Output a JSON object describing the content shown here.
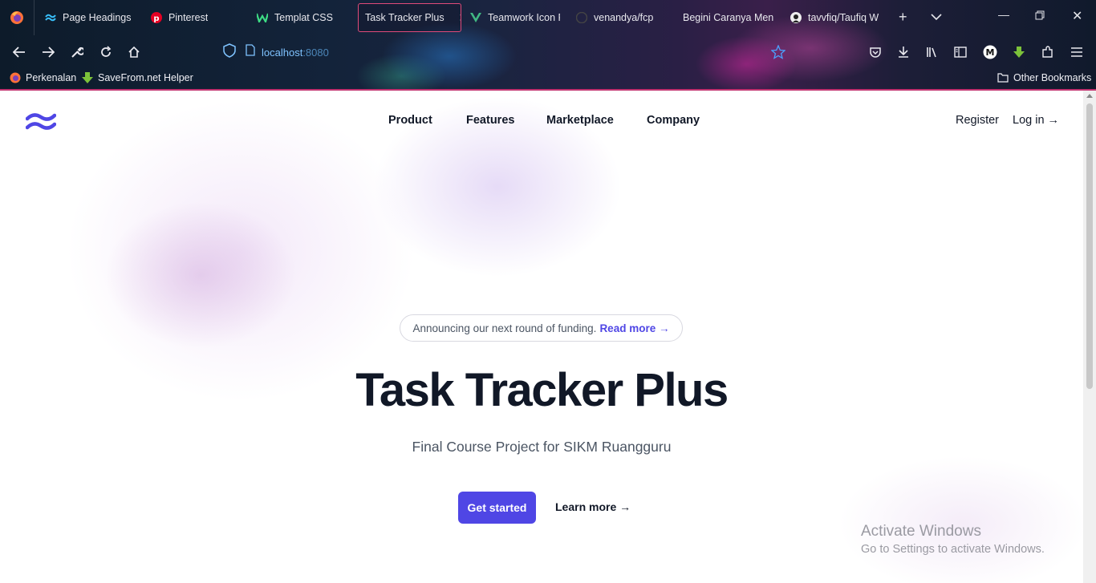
{
  "browser": {
    "tabs": [
      {
        "label": "Page Headings",
        "icon": "tailwind-icon"
      },
      {
        "label": "Pinterest",
        "icon": "pinterest-icon"
      },
      {
        "label": "Templat CSS",
        "icon": "w-icon"
      },
      {
        "label": "Task Tracker Plus",
        "icon": "",
        "active": true
      },
      {
        "label": "Teamwork Icon P",
        "icon": "vue-icon"
      },
      {
        "label": "venandya/fcp",
        "icon": "github-icon"
      },
      {
        "label": "Begini Caranya Men",
        "icon": ""
      },
      {
        "label": "tavvfiq/Taufiq W",
        "icon": "github-icon"
      }
    ],
    "url_host": "localhost",
    "url_port": ":8080",
    "bookmarks": [
      {
        "label": "Perkenalan",
        "icon": "firefox-icon"
      },
      {
        "label": "SaveFrom.net Helper",
        "icon": "download-arrow-icon"
      }
    ],
    "other_bookmarks": "Other Bookmarks",
    "profile_initial": "M",
    "colors": {
      "active_tab_border": "#e04a7a",
      "url_text": "#7fc3ff"
    }
  },
  "page": {
    "nav": {
      "items": [
        "Product",
        "Features",
        "Marketplace",
        "Company"
      ],
      "register": "Register",
      "login": "Log in →"
    },
    "announcement": {
      "text": "Announcing our next round of funding.",
      "link": "Read more →"
    },
    "hero": {
      "title": "Task Tracker Plus",
      "subtitle": "Final Course Project for SIKM Ruangguru",
      "primary_button": "Get started",
      "secondary_link": "Learn more →"
    },
    "colors": {
      "accent": "#4f46e5",
      "heading": "#111827"
    }
  },
  "watermark": {
    "line1": "Activate Windows",
    "line2": "Go to Settings to activate Windows."
  }
}
